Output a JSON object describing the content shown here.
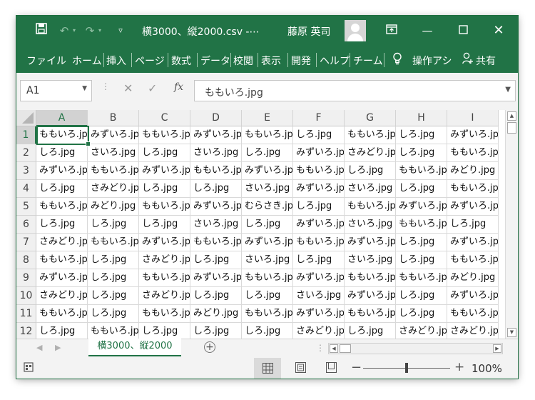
{
  "titlebar": {
    "title": "横3000、縦2000.csv  -⋯",
    "user": "藤原 英司",
    "icons": [
      "save-icon",
      "undo-icon",
      "redo-icon",
      "customize-icon",
      "ribbon-display-icon",
      "minimize-icon",
      "maximize-icon",
      "close-icon"
    ]
  },
  "ribbon": {
    "tabs": [
      "ファイル",
      "ホーム",
      "挿入",
      "ページ",
      "数式",
      "データ",
      "校閲",
      "表示",
      "開発",
      "ヘルプ",
      "チーム"
    ],
    "tell_me": "操作アシ",
    "share": "共有"
  },
  "formula_bar": {
    "name_box": "A1",
    "fx": "fx",
    "formula": "ももいろ.jpg"
  },
  "grid": {
    "columns": [
      "A",
      "B",
      "C",
      "D",
      "E",
      "F",
      "G",
      "H",
      "I"
    ],
    "rows": [
      "1",
      "2",
      "3",
      "4",
      "5",
      "6",
      "7",
      "8",
      "9",
      "10",
      "11",
      "12"
    ],
    "cells": [
      [
        "ももいろ.jpg",
        "みずいろ.jpg",
        "ももいろ.jpg",
        "みずいろ.jpg",
        "ももいろ.jpg",
        "しろ.jpg",
        "ももいろ.jpg",
        "しろ.jpg",
        "みずいろ.jpg"
      ],
      [
        "しろ.jpg",
        "さいろ.jpg",
        "しろ.jpg",
        "さいろ.jpg",
        "しろ.jpg",
        "みずいろ.jpg",
        "さみどり.jpg",
        "しろ.jpg",
        "ももいろ.jpg"
      ],
      [
        "みずいろ.jpg",
        "ももいろ.jpg",
        "みずいろ.jpg",
        "ももいろ.jpg",
        "みずいろ.jpg",
        "ももいろ.jpg",
        "しろ.jpg",
        "ももいろ.jpg",
        "みどり.jpg"
      ],
      [
        "しろ.jpg",
        "さみどり.jpg",
        "しろ.jpg",
        "しろ.jpg",
        "さいろ.jpg",
        "みずいろ.jpg",
        "さいろ.jpg",
        "しろ.jpg",
        "ももいろ.jpg"
      ],
      [
        "ももいろ.jpg",
        "みどり.jpg",
        "ももいろ.jpg",
        "みずいろ.jpg",
        "むらさき.jpg",
        "しろ.jpg",
        "ももいろ.jpg",
        "みずいろ.jpg",
        "みずいろ.jpg"
      ],
      [
        "しろ.jpg",
        "しろ.jpg",
        "しろ.jpg",
        "さいろ.jpg",
        "しろ.jpg",
        "みずいろ.jpg",
        "さいろ.jpg",
        "ももいろ.jpg",
        "しろ.jpg"
      ],
      [
        "さみどり.jpg",
        "ももいろ.jpg",
        "みずいろ.jpg",
        "ももいろ.jpg",
        "みずいろ.jpg",
        "ももいろ.jpg",
        "みずいろ.jpg",
        "しろ.jpg",
        "みずいろ.jpg"
      ],
      [
        "ももいろ.jpg",
        "しろ.jpg",
        "さみどり.jpg",
        "しろ.jpg",
        "さいろ.jpg",
        "しろ.jpg",
        "さいろ.jpg",
        "しろ.jpg",
        "ももいろ.jpg"
      ],
      [
        "みずいろ.jpg",
        "しろ.jpg",
        "ももいろ.jpg",
        "みずいろ.jpg",
        "ももいろ.jpg",
        "みずいろ.jpg",
        "ももいろ.jpg",
        "ももいろ.jpg",
        "みどり.jpg"
      ],
      [
        "さみどり.jpg",
        "しろ.jpg",
        "さみどり.jpg",
        "しろ.jpg",
        "しろ.jpg",
        "さいろ.jpg",
        "みずいろ.jpg",
        "しろ.jpg",
        "みずいろ.jpg"
      ],
      [
        "ももいろ.jpg",
        "しろ.jpg",
        "ももいろ.jpg",
        "みどり.jpg",
        "ももいろ.jpg",
        "みずいろ.jpg",
        "ももいろ.jpg",
        "しろ.jpg",
        "ももいろ.jpg"
      ],
      [
        "しろ.jpg",
        "ももいろ.jpg",
        "しろ.jpg",
        "しろ.jpg",
        "しろ.jpg",
        "さみどり.jpg",
        "しろ.jpg",
        "さみどり.jpg",
        "さみどり.jpg"
      ]
    ]
  },
  "sheet_tabs": {
    "active": "横3000、縦2000",
    "add": "+"
  },
  "status_bar": {
    "zoom_minus": "−",
    "zoom_plus": "+",
    "zoom": "100%",
    "zoom_level_percent": 100
  },
  "colors": {
    "brand": "#217346",
    "selection_header": "#d2d2d2"
  }
}
